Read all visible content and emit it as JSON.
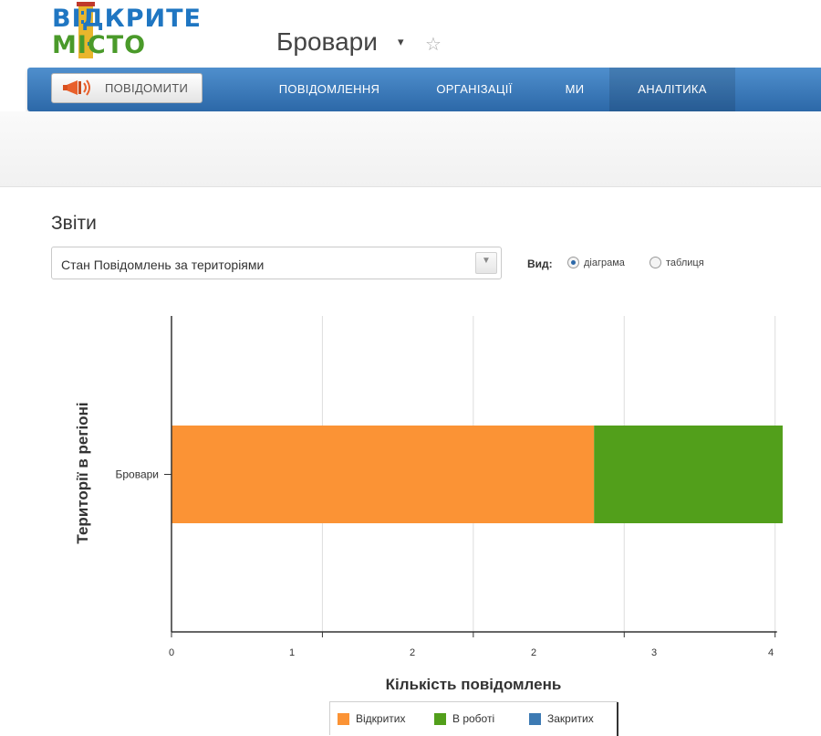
{
  "logo": {
    "line1": "ВІДКРИТЕ",
    "line2": "МІСТО"
  },
  "header": {
    "city": "Бровари",
    "caret_icon": "▾",
    "star_icon": "☆"
  },
  "nav": {
    "report_button": "ПОВІДОМИТИ",
    "items": [
      {
        "label": "ПОВІДОМЛЕННЯ",
        "active": false
      },
      {
        "label": "ОРГАНІЗАЦІЇ",
        "active": false
      },
      {
        "label": "МИ",
        "active": false
      },
      {
        "label": "АНАЛІТИКА",
        "active": true
      }
    ]
  },
  "reports": {
    "title": "Звіти",
    "selected_report": "Стан Повідомлень за територіями",
    "view_label": "Вид:",
    "view_options": [
      {
        "label": "діаграма",
        "checked": true
      },
      {
        "label": "таблиця",
        "checked": false
      }
    ]
  },
  "colors": {
    "open": "#fb9335",
    "in_progress": "#529f1b",
    "closed": "#3d7ab3",
    "nav": "#2c68a8"
  },
  "chart_data": {
    "type": "bar",
    "orientation": "horizontal",
    "stacked": true,
    "categories": [
      "Бровари"
    ],
    "series": [
      {
        "name": "Відкритих",
        "values": [
          2.8
        ]
      },
      {
        "name": "В роботі",
        "values": [
          1.25
        ]
      },
      {
        "name": "Закритих",
        "values": [
          0
        ]
      }
    ],
    "xlabel": "Кількість повідомлень",
    "ylabel": "Території в регіоні",
    "x_ticks": [
      0,
      1,
      2,
      3,
      4
    ],
    "x_tick_labels": [
      "0",
      "1",
      "2",
      "2",
      "3",
      "4"
    ],
    "xlim": [
      0,
      5
    ],
    "grid": true,
    "legend": "bottom"
  }
}
